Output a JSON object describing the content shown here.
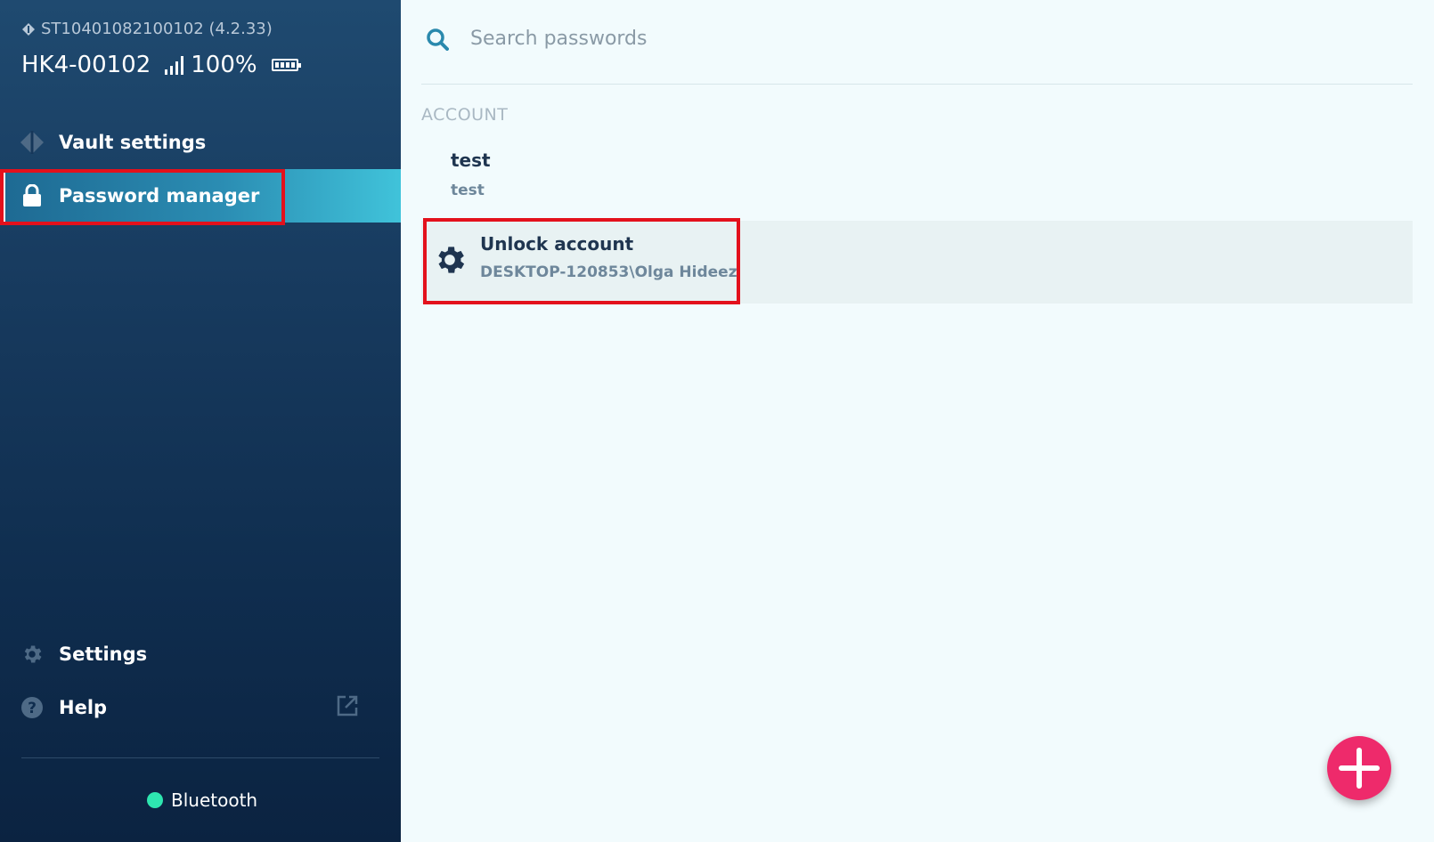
{
  "sidebar": {
    "device_id": "ST10401082100102 (4.2.33)",
    "device_name": "HK4-00102",
    "signal_percent": "100%",
    "battery_level": 1.0,
    "nav": {
      "vault_settings": "Vault settings",
      "password_manager": "Password manager",
      "settings": "Settings",
      "help": "Help"
    },
    "connection": "Bluetooth",
    "connection_color": "#2ee6b0"
  },
  "main": {
    "search_placeholder": "Search passwords",
    "section_header": "ACCOUNT",
    "accounts": [
      {
        "name": "test",
        "login": "test",
        "icon": null
      },
      {
        "name": "Unlock account",
        "login": "DESKTOP-120853\\Olga Hideez",
        "icon": "gear-icon"
      }
    ],
    "add_button_icon": "plus-icon"
  },
  "colors": {
    "accent": "#40c3da",
    "fab": "#ee2a6b",
    "highlight": "#e3111c"
  }
}
